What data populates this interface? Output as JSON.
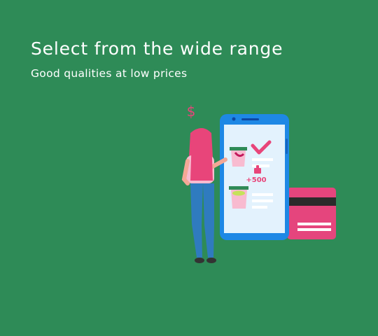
{
  "onboarding": {
    "title": "Select from the wide range",
    "subtitle": "Good qualities at low prices"
  },
  "illustration": {
    "dollar_symbol": "$",
    "badge_text": "+500"
  },
  "colors": {
    "background": "#2e8b57",
    "phone_frame": "#1e88e5",
    "screen": "#e3f2fd",
    "accent_pink": "#e8457a",
    "jeans": "#2f7bbf",
    "card": "#e5457d"
  }
}
